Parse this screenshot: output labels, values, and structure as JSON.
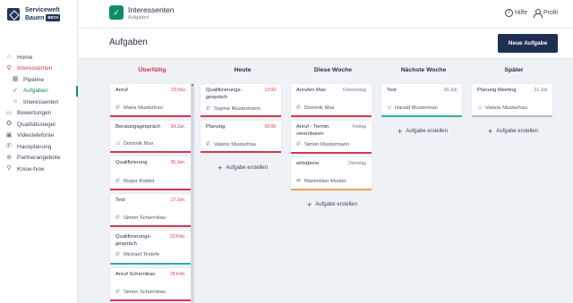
{
  "brand": {
    "name_line1": "Servicewelt",
    "name_line2": "Bauen",
    "badge": "BETA"
  },
  "header": {
    "app_title": "Interessenten",
    "app_subtitle": "Aufgaben",
    "help_label": "Hilfe",
    "profile_label": "Profil"
  },
  "sidebar": {
    "items": [
      {
        "label": "Home",
        "icon": "home-icon"
      },
      {
        "label": "Interessenten",
        "icon": "pin-icon"
      },
      {
        "label": "Pipeline",
        "icon": "grid-icon"
      },
      {
        "label": "Aufgaben",
        "icon": "check-circle-icon"
      },
      {
        "label": "Interessenten",
        "icon": "person-icon"
      },
      {
        "label": "Bewertungen",
        "icon": "chat-icon"
      },
      {
        "label": "Qualitätssiegel",
        "icon": "badge-icon"
      },
      {
        "label": "Videotelefonie",
        "icon": "video-icon"
      },
      {
        "label": "Hausplanung",
        "icon": "phone-icon"
      },
      {
        "label": "Partnerangebote",
        "icon": "gift-icon"
      },
      {
        "label": "Know-how",
        "icon": "pin-icon"
      }
    ]
  },
  "page": {
    "title": "Aufgaben",
    "new_task_label": "Neue Aufgabe"
  },
  "board": {
    "add_task_label": "Aufgabe erstellen",
    "columns": [
      {
        "title": "Überfällig"
      },
      {
        "title": "Heute"
      },
      {
        "title": "Diese Woche"
      },
      {
        "title": "Nächste Woche"
      },
      {
        "title": "Später"
      }
    ],
    "overdue": [
      {
        "title": "Anruf",
        "date": "23.Nov",
        "person": "Marie Musterfrau",
        "type": "phone"
      },
      {
        "title": "Beratungsgespräch",
        "date": "04.Jan.",
        "person": "Dominik Max",
        "type": "person"
      },
      {
        "title": "Qualifizierung",
        "date": "05.Jan.",
        "person": "Roger Rabbit",
        "type": "phone"
      },
      {
        "title": "Test",
        "date": "17.Jan.",
        "person": "Simon Schernikau",
        "type": "phone"
      },
      {
        "title": "Qualifizierungs-gespräch",
        "date": "22.Feb.",
        "person": "Michael Testefe",
        "type": "phone"
      },
      {
        "title": "Anruf Schernikau",
        "date": "29.Feb.",
        "person": "Simon Schernikau",
        "type": "phone"
      }
    ],
    "today": [
      {
        "title": "Qualifizierungs-gespräch",
        "date": "12:00",
        "person": "Sophie Mustermann",
        "type": "phone"
      },
      {
        "title": "Planung",
        "date": "09:00",
        "person": "Valerie Musterfrau",
        "type": "phone"
      }
    ],
    "this_week": [
      {
        "title": "Anrufen Max",
        "date": "Donnerstag",
        "person": "Dominik Max",
        "type": "phone"
      },
      {
        "title": "Anruf - Termin vereinbaren",
        "date": "Freitag",
        "person": "Simon Mustermann",
        "type": "phone"
      },
      {
        "title": "wrbqbnrw",
        "date": "Dienstag",
        "person": "Maximilian Muster",
        "type": "mail"
      }
    ],
    "next_week": [
      {
        "title": "Test",
        "date": "26.Juli",
        "person": "Harald Musterman",
        "type": "person"
      }
    ],
    "later": [
      {
        "title": "Planung Meeting",
        "date": "31.Juli",
        "person": "Valerie Musterfrau",
        "type": "person"
      }
    ]
  },
  "colors": {
    "accent": "#0f8d6b",
    "overdue": "#d13a52",
    "primary_button": "#1f2f53",
    "teal_bar": "#2bb3a3",
    "orange_bar": "#f0a05a"
  }
}
